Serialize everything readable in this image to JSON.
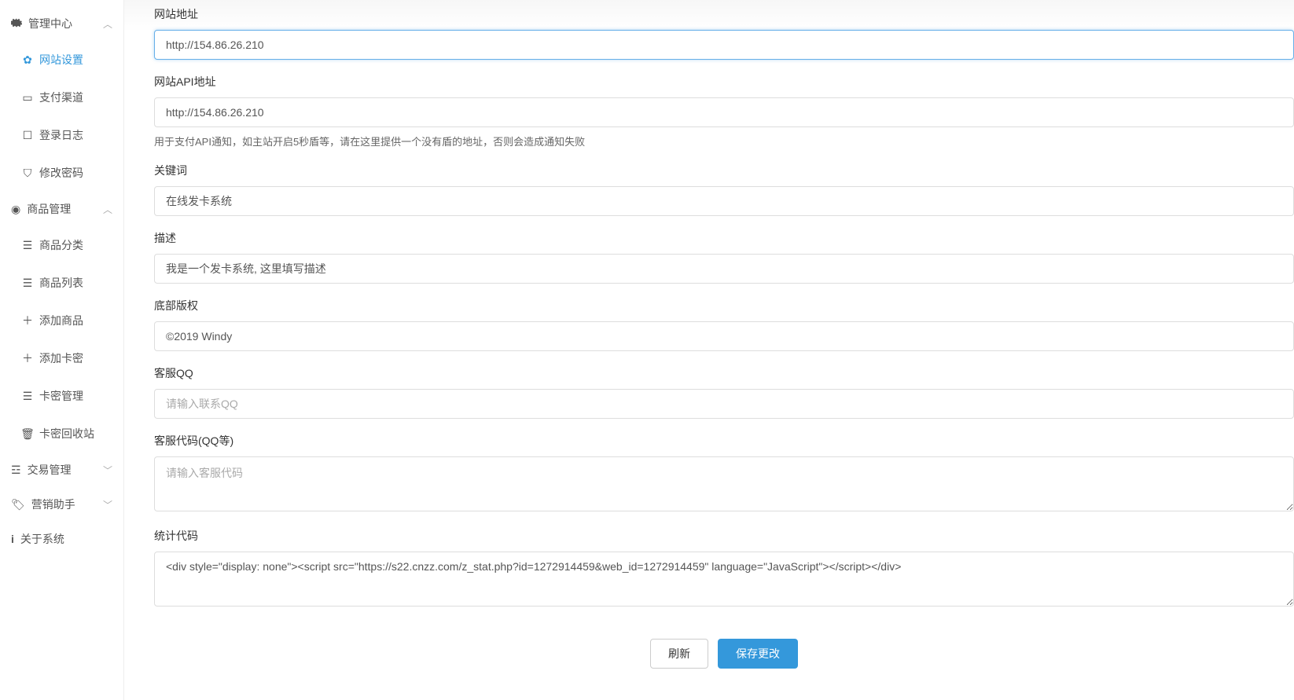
{
  "sidebar": {
    "groups": [
      {
        "label": "管理中心",
        "icon": "gears-icon",
        "expanded": true,
        "items": [
          {
            "label": "网站设置",
            "icon": "gear-icon",
            "active": true
          },
          {
            "label": "支付渠道",
            "icon": "card-icon",
            "active": false
          },
          {
            "label": "登录日志",
            "icon": "file-icon",
            "active": false
          },
          {
            "label": "修改密码",
            "icon": "shield-icon",
            "active": false
          }
        ]
      },
      {
        "label": "商品管理",
        "icon": "dashboard-icon",
        "expanded": true,
        "items": [
          {
            "label": "商品分类",
            "icon": "list-icon",
            "active": false
          },
          {
            "label": "商品列表",
            "icon": "list-icon",
            "active": false
          },
          {
            "label": "添加商品",
            "icon": "plus-icon",
            "active": false
          },
          {
            "label": "添加卡密",
            "icon": "plus-icon",
            "active": false
          },
          {
            "label": "卡密管理",
            "icon": "list-icon",
            "active": false
          },
          {
            "label": "卡密回收站",
            "icon": "trash-icon",
            "active": false
          }
        ]
      },
      {
        "label": "交易管理",
        "icon": "list-icon",
        "expanded": false,
        "items": []
      },
      {
        "label": "营销助手",
        "icon": "tag-icon",
        "expanded": false,
        "items": []
      },
      {
        "label": "关于系统",
        "icon": "info-icon",
        "expanded": null,
        "items": []
      }
    ]
  },
  "form": {
    "site_url": {
      "label": "网站地址",
      "value": "http://154.86.26.210"
    },
    "api_url": {
      "label": "网站API地址",
      "value": "http://154.86.26.210",
      "help": "用于支付API通知，如主站开启5秒盾等，请在这里提供一个没有盾的地址，否则会造成通知失败"
    },
    "keywords": {
      "label": "关键词",
      "value": "在线发卡系统"
    },
    "description": {
      "label": "描述",
      "value": "我是一个发卡系统, 这里填写描述"
    },
    "footer": {
      "label": "底部版权",
      "value": "©2019 Windy"
    },
    "service_qq": {
      "label": "客服QQ",
      "value": "",
      "placeholder": "请输入联系QQ"
    },
    "service_code": {
      "label": "客服代码(QQ等)",
      "value": "",
      "placeholder": "请输入客服代码"
    },
    "stats_code": {
      "label": "统计代码",
      "value": "<div style=\"display: none\"><script src=\"https://s22.cnzz.com/z_stat.php?id=1272914459&web_id=1272914459\" language=\"JavaScript\"></script></div>"
    }
  },
  "buttons": {
    "refresh": "刷新",
    "save": "保存更改"
  }
}
